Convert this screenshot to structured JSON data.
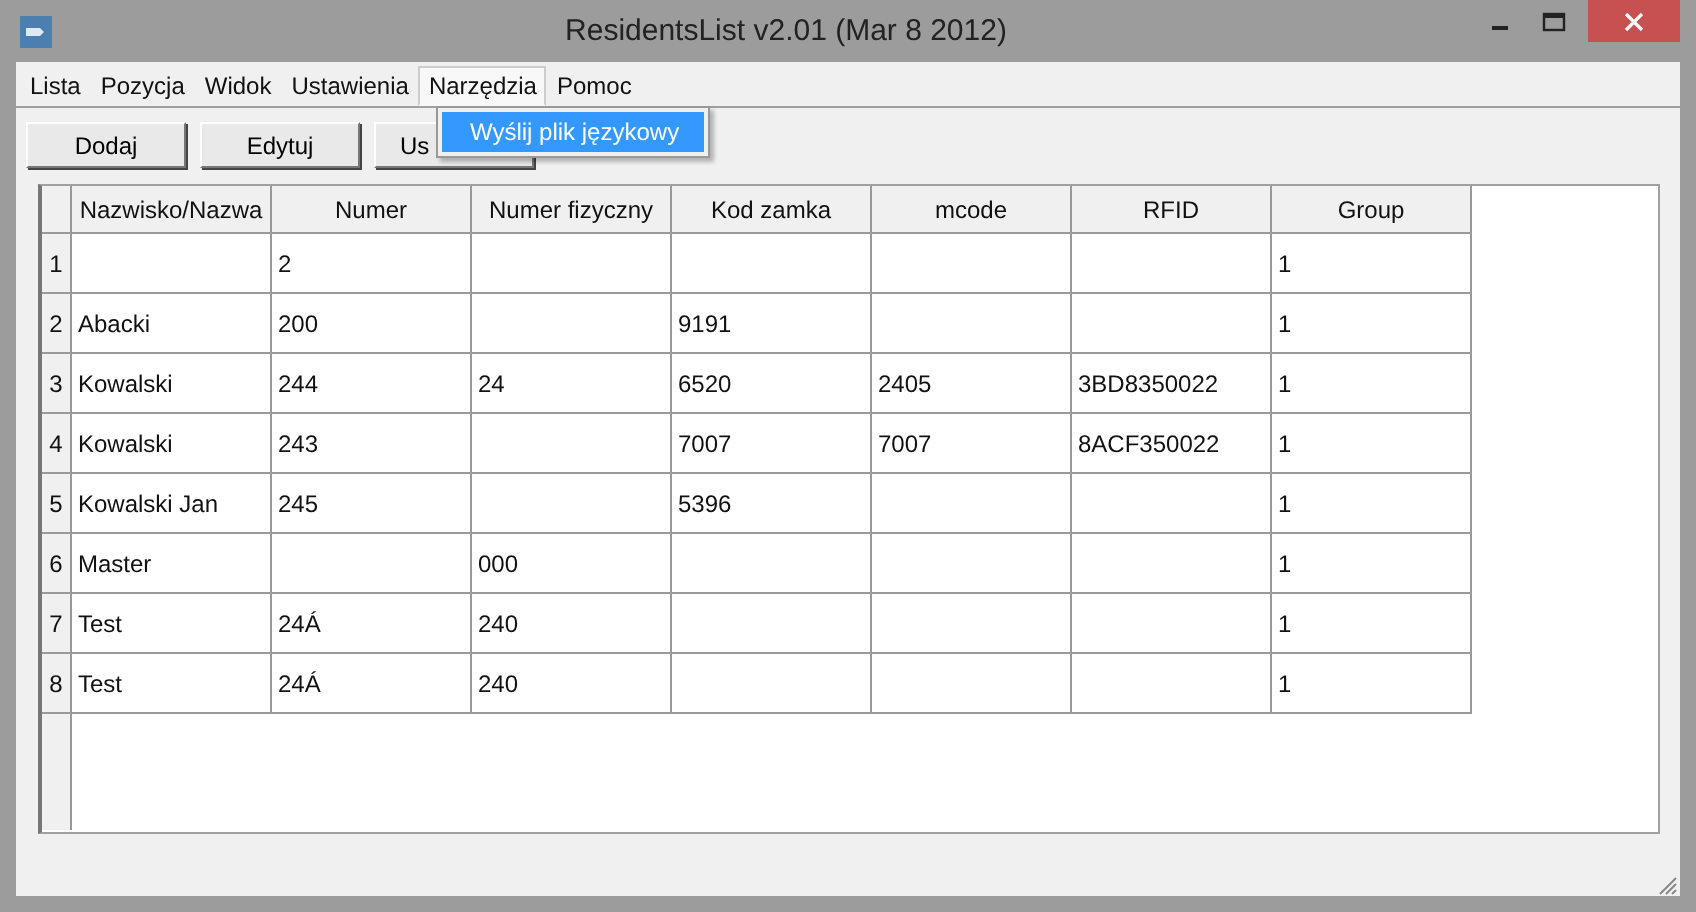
{
  "window": {
    "title": "ResidentsList v2.01  (Mar  8 2012)"
  },
  "menu": [
    {
      "label": "Lista",
      "selected": false
    },
    {
      "label": "Pozycja",
      "selected": false
    },
    {
      "label": "Widok",
      "selected": false
    },
    {
      "label": "Ustawienia",
      "selected": false
    },
    {
      "label": "Narzędzia",
      "selected": true
    },
    {
      "label": "Pomoc",
      "selected": false
    }
  ],
  "dropdown": {
    "items": [
      {
        "label": "Wyślij plik językowy",
        "selected": true
      }
    ]
  },
  "buttons": [
    "Dodaj",
    "Edytuj",
    "Us"
  ],
  "table": {
    "columns": [
      "Nazwisko/Nazwa",
      "Numer",
      "Numer fizyczny",
      "Kod zamka",
      "mcode",
      "RFID",
      "Group"
    ],
    "rows": [
      {
        "number": "1",
        "cells": [
          "",
          "2",
          "",
          "",
          "",
          "",
          "1"
        ]
      },
      {
        "number": "2",
        "cells": [
          "Abacki",
          "200",
          "",
          "9191",
          "",
          "",
          "1"
        ]
      },
      {
        "number": "3",
        "cells": [
          "Kowalski",
          "244",
          "24",
          "6520",
          "2405",
          "3BD8350022",
          "1"
        ]
      },
      {
        "number": "4",
        "cells": [
          "Kowalski",
          "243",
          "",
          "7007",
          "7007",
          "8ACF350022",
          "1"
        ]
      },
      {
        "number": "5",
        "cells": [
          "Kowalski Jan",
          "245",
          "",
          "5396",
          "",
          "",
          "1"
        ]
      },
      {
        "number": "6",
        "cells": [
          "Master",
          "",
          "000",
          "",
          "",
          "",
          "1"
        ]
      },
      {
        "number": "7",
        "cells": [
          "Test",
          "24Á",
          "240",
          "",
          "",
          "",
          "1"
        ]
      },
      {
        "number": "8",
        "cells": [
          "Test",
          "24Á",
          "240",
          "",
          "",
          "",
          "1"
        ]
      }
    ]
  }
}
